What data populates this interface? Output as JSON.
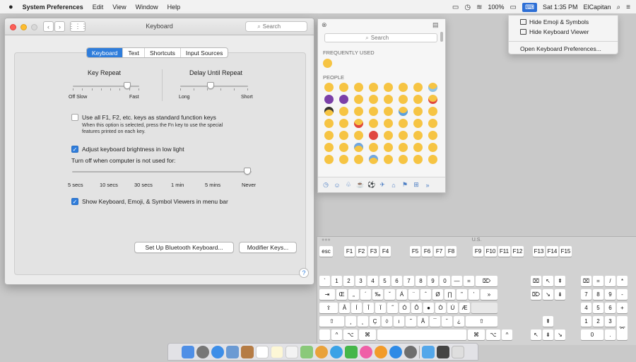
{
  "menubar": {
    "apple": "",
    "app_name": "System Preferences",
    "items": [
      "Edit",
      "View",
      "Window",
      "Help"
    ],
    "battery": "100%",
    "clock": "Sat 1:35 PM",
    "user": "ElCapitan"
  },
  "input_menu": {
    "hide_emoji": "Hide Emoji & Symbols",
    "hide_viewer": "Hide Keyboard Viewer",
    "open_prefs": "Open Keyboard Preferences..."
  },
  "window": {
    "title": "Keyboard",
    "search_placeholder": "Search",
    "tabs": [
      "Keyboard",
      "Text",
      "Shortcuts",
      "Input Sources"
    ],
    "key_repeat": {
      "label": "Key Repeat",
      "min": "Off",
      "min2": "Slow",
      "max": "Fast",
      "value_fraction": 0.83
    },
    "delay_repeat": {
      "label": "Delay Until Repeat",
      "min": "Long",
      "max": "Short",
      "value_fraction": 0.5
    },
    "fn_checkbox": {
      "label": "Use all F1, F2, etc. keys as standard function keys",
      "checked": false
    },
    "fn_note_1": "When this option is selected, press the Fn key to use the special",
    "fn_note_2": "features printed on each key.",
    "brightness_checkbox": {
      "label": "Adjust keyboard brightness in low light",
      "checked": true
    },
    "turn_off_label": "Turn off when computer is not used for:",
    "turn_off_ticks": [
      "5 secs",
      "10 secs",
      "30 secs",
      "1 min",
      "5 mins",
      "Never"
    ],
    "turn_off_value": "Never",
    "viewers_checkbox": {
      "label": "Show Keyboard, Emoji, & Symbol Viewers in menu bar",
      "checked": true
    },
    "bluetooth_button": "Set Up Bluetooth Keyboard...",
    "modifier_button": "Modifier Keys...",
    "help": "?"
  },
  "emoji_palette": {
    "search_placeholder": "Search",
    "frequently_used": "FREQUENTLY USED",
    "people": "PEOPLE",
    "more": "»"
  },
  "keyboard_viewer": {
    "title": "U.S.",
    "row_fn": [
      "esc",
      "F1",
      "F2",
      "F3",
      "F4",
      "F5",
      "F6",
      "F7",
      "F8",
      "F9",
      "F10",
      "F11",
      "F12",
      "F13",
      "F14",
      "F15"
    ],
    "row1": [
      "`",
      "1",
      "2",
      "3",
      "4",
      "5",
      "6",
      "7",
      "8",
      "9",
      "0",
      "—",
      "=",
      "⌦"
    ],
    "row2": [
      "⇥",
      "Œ",
      "„",
      "´",
      "‰",
      "ˇ",
      "Á",
      "¨",
      "ˆ",
      "Ø",
      "∏",
      "”",
      "’",
      "»"
    ],
    "row3": [
      "⇪",
      "Å",
      "Í",
      "Î",
      "Ï",
      "˝",
      "Ó",
      "Ô",
      "",
      "Ò",
      "Ú",
      "Æ"
    ],
    "row4": [
      "⇧",
      "¸",
      "˛",
      "Ç",
      "◊",
      "ı",
      "˜",
      "Â",
      "¯",
      "˘",
      "¿",
      "⇧"
    ],
    "row5": [
      "^",
      "⌥",
      "⌘",
      "⌘",
      "⌥",
      "^"
    ],
    "nav_top": [
      "⌧",
      "↖",
      "⇞"
    ],
    "nav_mid": [
      "⌦",
      "↘",
      "⇟"
    ],
    "arrows": [
      "⇞",
      "↖",
      "⇟",
      "↘"
    ],
    "numpad": [
      [
        "⌧",
        "=",
        "/",
        "*"
      ],
      [
        "7",
        "8",
        "9",
        "-"
      ],
      [
        "4",
        "5",
        "6",
        "+"
      ],
      [
        "1",
        "2",
        "3",
        "⌤"
      ],
      [
        "0",
        "."
      ]
    ]
  },
  "colors": {
    "accent": "#2f7ddb",
    "emoji_yellow": "#f6c443",
    "emoji_purple": "#7b3fa8"
  }
}
